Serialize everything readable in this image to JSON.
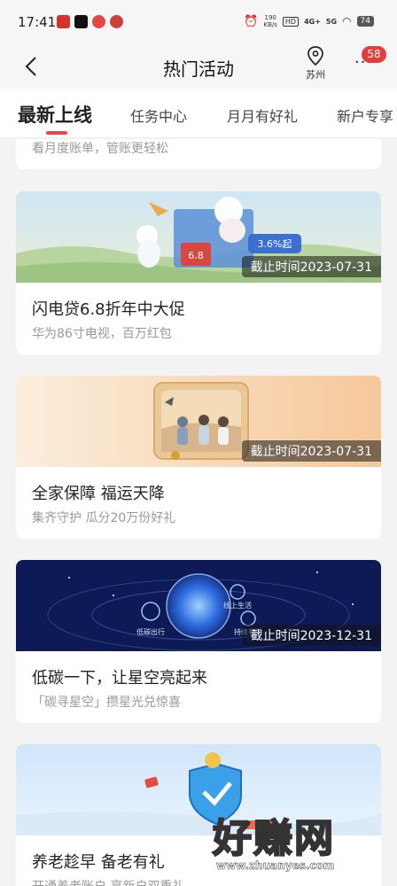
{
  "status": {
    "time": "17:41",
    "net_speed": "190\nKB/s",
    "hd_label": "HD",
    "sig1": "4G+",
    "sig2": "5G",
    "battery": "74"
  },
  "header": {
    "title": "热门活动",
    "city": "苏州",
    "more_glyph": "···",
    "badge_count": "58"
  },
  "tabs": [
    {
      "label": "最新上线",
      "active": true
    },
    {
      "label": "任务中心",
      "active": false
    },
    {
      "label": "月月有好礼",
      "active": false
    },
    {
      "label": "新户专享",
      "active": false
    }
  ],
  "cards": [
    {
      "title": "",
      "subtitle": "看月度账单，管账更轻松",
      "deadline": ""
    },
    {
      "title": "闪电贷6.8折年中大促",
      "subtitle": "华为86寸电视，百万红包",
      "deadline": "截止时间2023-07-31",
      "banner_text_rate": "3.6%起",
      "banner_text_badge": "6.8"
    },
    {
      "title": "全家保障 福运天降",
      "subtitle": "集齐守护  瓜分20万份好礼",
      "deadline": "截止时间2023-07-31"
    },
    {
      "title": "低碳一下，让星空亮起来",
      "subtitle": "「碳寻星空」攒星光兑惊喜",
      "deadline": "截止时间2023-12-31",
      "banner_text_a": "低碳出行",
      "banner_text_b": "线上生活",
      "banner_text_c": "持续有效"
    },
    {
      "title": "养老趁早 备老有礼",
      "subtitle": "开通养老账户 享新户双重礼",
      "deadline": ""
    }
  ],
  "watermark": {
    "text": "好赚网",
    "url": "www.zhuanyes.com"
  },
  "colors": {
    "accent": "#e04a4a",
    "badge": "#e33e3e"
  }
}
